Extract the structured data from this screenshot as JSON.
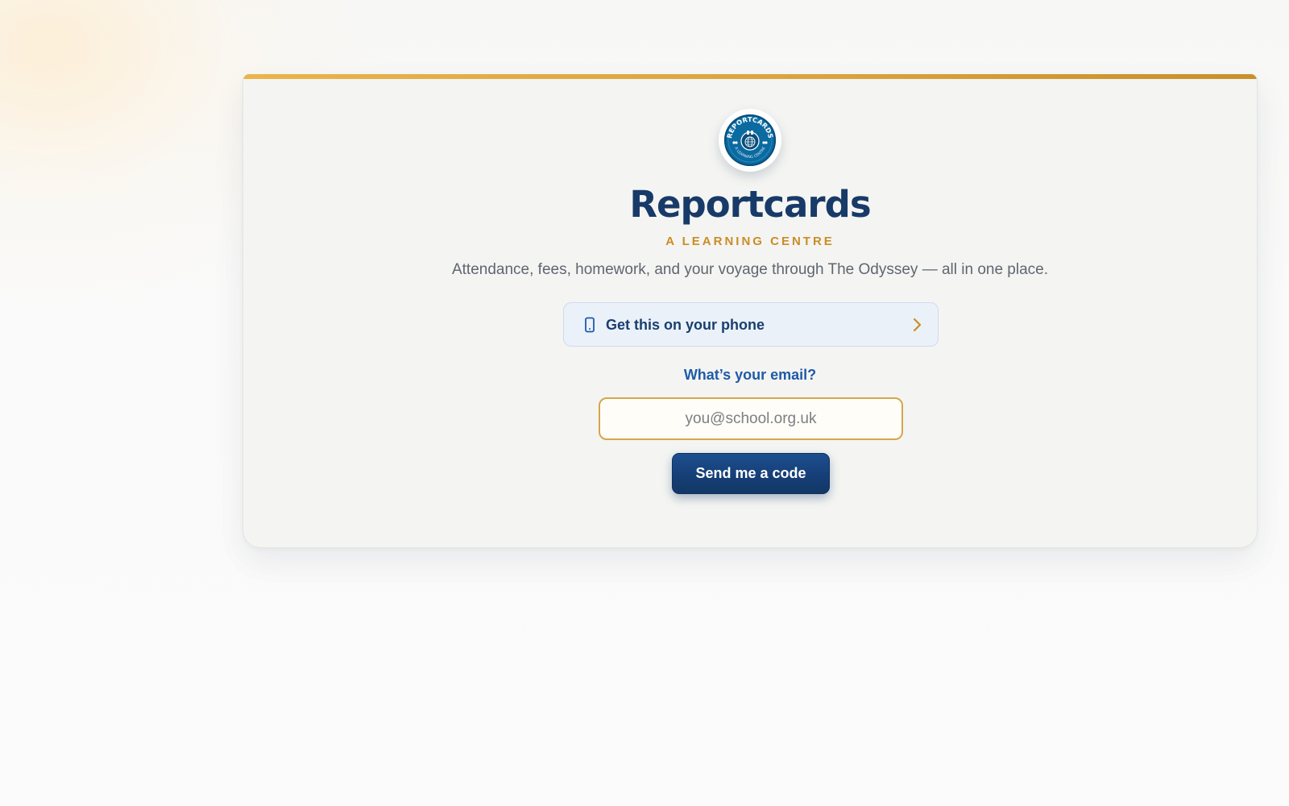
{
  "logo": {
    "arc_top_text": "REPORTCARDS",
    "arc_bottom_text": "A LEARNING CENTRE",
    "icon": "globe-icon"
  },
  "brand": {
    "title": "Reportcards",
    "subtitle": "A LEARNING CENTRE",
    "tagline": "Attendance, fees, homework, and your voyage through The Odyssey — all in one place."
  },
  "phone_banner": {
    "label": "Get this on your phone",
    "icon": "phone-icon",
    "trailing_icon": "chevron-right-icon"
  },
  "login_form": {
    "email_label": "What’s your email?",
    "email_value": "",
    "email_placeholder": "you@school.org.uk",
    "submit_label": "Send me a code"
  },
  "colors": {
    "brand_navy": "#173a68",
    "accent_gold": "#c98d23",
    "label_blue": "#1f5aa8",
    "button_navy": "#163f77"
  }
}
